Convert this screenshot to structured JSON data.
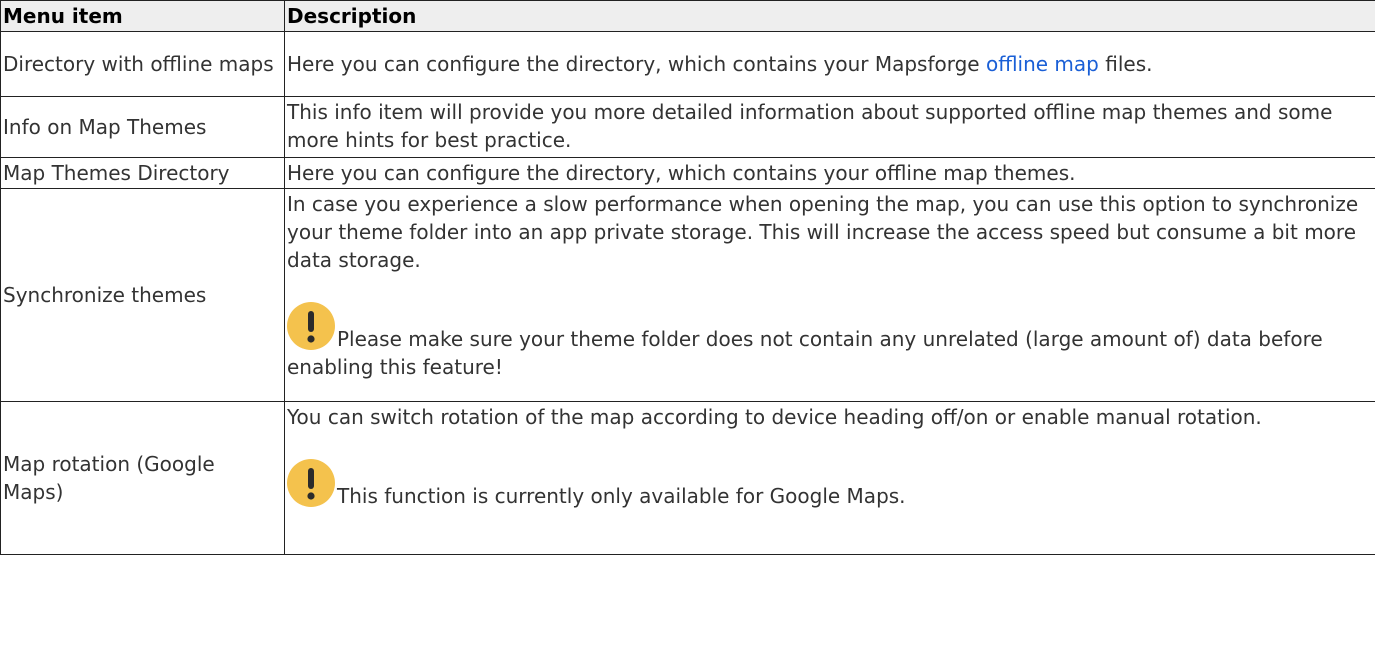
{
  "table": {
    "headers": {
      "item": "Menu item",
      "description": "Description"
    },
    "rows": [
      {
        "item": "Directory with offline maps",
        "desc_before": "Here you can configure the directory, which contains your Mapsforge ",
        "desc_link": "offline map",
        "desc_after": " files."
      },
      {
        "item": "Info on Map Themes",
        "desc": "This info item will provide you more detailed information about supported offline map themes and some more hints for best practice."
      },
      {
        "item": "Map Themes Directory",
        "desc": "Here you can configure the directory, which contains your offline map themes."
      },
      {
        "item": "Synchronize themes",
        "desc": "In case you experience a slow performance when opening the map, you can use this option to synchronize your theme folder into an app private storage. This will increase the access speed but consume a bit more data storage.",
        "note_icon": "exclamation-warning-icon",
        "note": "Please make sure your theme folder does not contain any unrelated (large amount of) data before enabling this feature!"
      },
      {
        "item": "Map rotation (Google Maps)",
        "desc": "You can switch rotation of the map according to device heading off/on or enable manual rotation.",
        "note_icon": "exclamation-warning-icon",
        "note": "This function is currently only available for Google Maps."
      }
    ]
  },
  "colors": {
    "header_bg": "#eeeeee",
    "border": "#222222",
    "text": "#333333",
    "link": "#1a5fd6",
    "warn_icon": "#f4c24d"
  }
}
